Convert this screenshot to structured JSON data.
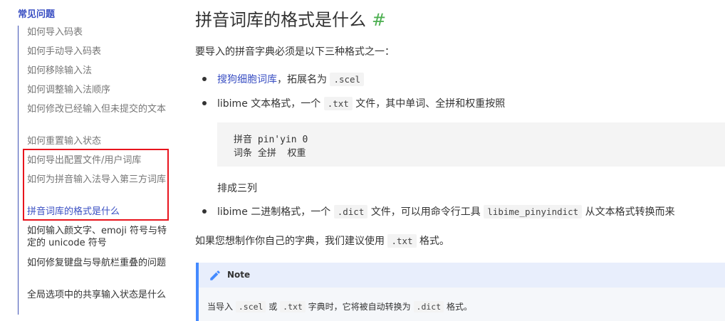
{
  "sidebar": {
    "section_title": "常见问题",
    "items": [
      {
        "label": "如何导入码表"
      },
      {
        "label": "如何手动导入码表"
      },
      {
        "label": "如何移除输入法"
      },
      {
        "label": "如何调整输入法顺序"
      },
      {
        "label": "如何修改已经输入但未提交的文本"
      },
      {
        "label": "如何重置输入状态"
      },
      {
        "label": "如何导出配置文件/用户词库"
      },
      {
        "label": "如何为拼音输入法导入第三方词库"
      },
      {
        "label": "拼音词库的格式是什么"
      },
      {
        "label": "如何输入颜文字、emoji 符号与特定的 unicode 符号"
      },
      {
        "label": "如何修复键盘与导航栏重叠的问题"
      },
      {
        "label": "全局选项中的共享输入状态是什么"
      }
    ]
  },
  "article": {
    "title": "拼音词库的格式是什么",
    "anchor": "#",
    "intro": "要导入的拼音字典必须是以下三种格式之一：",
    "bullet1": {
      "link": "搜狗细胞词库",
      "text": "，拓展名为",
      "code": ".scel"
    },
    "bullet2": {
      "pre": "libime 文本格式，一个",
      "code": ".txt",
      "post": "文件，其中单词、全拼和权重按照"
    },
    "codeblock": {
      "line1": "拼音 pin'yin 0",
      "line2": "词条 全拼  权重"
    },
    "after_code": "排成三列",
    "bullet3": {
      "pre": "libime 二进制格式，一个",
      "code1": ".dict",
      "mid": "文件，可以用命令行工具",
      "code2": "libime_pinyindict",
      "post": "从文本格式转换而来"
    },
    "suggest": {
      "pre": "如果您想制作你自己的字典，我们建议使用",
      "code": ".txt",
      "post": "格式。"
    },
    "note": {
      "title": "Note",
      "pre": "当导入",
      "code1": ".scel",
      "or": "或",
      "code2": ".txt",
      "mid": "字典时，它将被自动转换为",
      "code3": ".dict",
      "post": "格式。"
    }
  },
  "colors": {
    "accent": "#3a4fc3",
    "anchor": "#4caf50",
    "highlight_box": "#e8141d",
    "note_border": "#448aff"
  },
  "icons": {
    "note": "pencil-icon"
  }
}
